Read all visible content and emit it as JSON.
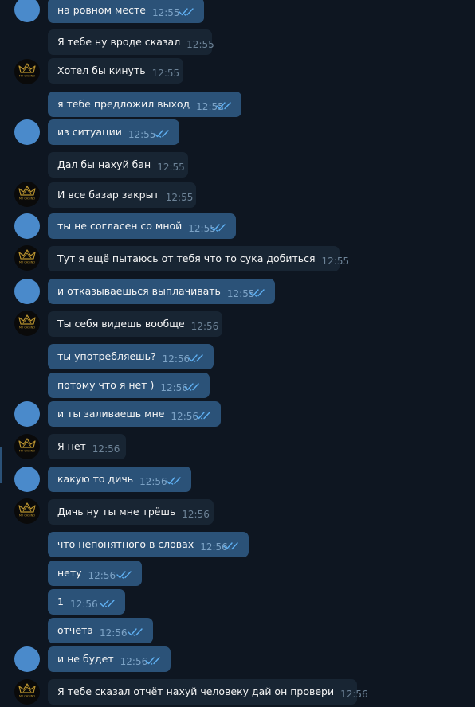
{
  "colors": {
    "background": "#0e1621",
    "outgoing_bubble": "#2b5278",
    "incoming_bubble": "#182533",
    "text": "#f5f5f5",
    "time_incoming": "#6d8397",
    "time_outgoing": "#7da3c6",
    "check_marks": "#5fb0f2",
    "avatar_blue": "#4a8acb",
    "logo_gold": "#b8922f"
  },
  "avatar_logo_text": "MY CASINO",
  "messages": [
    {
      "text": "на ровном месте",
      "time": "12:55",
      "direction": "out",
      "read": true
    },
    {
      "text": "Я тебе ну вроде сказал",
      "time": "12:55",
      "direction": "in",
      "read": false
    },
    {
      "text": "Хотел бы кинуть",
      "time": "12:55",
      "direction": "in",
      "read": false
    },
    {
      "text": "я тебе предложил выход",
      "time": "12:55",
      "direction": "out",
      "read": true
    },
    {
      "text": "из ситуации",
      "time": "12:55",
      "direction": "out",
      "read": true
    },
    {
      "text": "Дал бы нахуй бан",
      "time": "12:55",
      "direction": "in",
      "read": false
    },
    {
      "text": "И все базар закрыт",
      "time": "12:55",
      "direction": "in",
      "read": false
    },
    {
      "text": "ты не согласен со мной",
      "time": "12:55",
      "direction": "out",
      "read": true
    },
    {
      "text": "Тут я ещё пытаюсь от тебя что то сука добиться",
      "time": "12:55",
      "direction": "in",
      "read": false
    },
    {
      "text": "и отказываешься выплачивать",
      "time": "12:55",
      "direction": "out",
      "read": true
    },
    {
      "text": "Ты себя видешь вообще",
      "time": "12:56",
      "direction": "in",
      "read": false
    },
    {
      "text": "ты употребляешь?",
      "time": "12:56",
      "direction": "out",
      "read": true
    },
    {
      "text": "потому что я нет )",
      "time": "12:56",
      "direction": "out",
      "read": true
    },
    {
      "text": "и ты заливаешь мне",
      "time": "12:56",
      "direction": "out",
      "read": true
    },
    {
      "text": "Я нет",
      "time": "12:56",
      "direction": "in",
      "read": false
    },
    {
      "text": "какую то дичь",
      "time": "12:56",
      "direction": "out",
      "read": true
    },
    {
      "text": "Дичь ну ты мне трёшь",
      "time": "12:56",
      "direction": "in",
      "read": false
    },
    {
      "text": "что непонятного в словах",
      "time": "12:56",
      "direction": "out",
      "read": true
    },
    {
      "text": "нету",
      "time": "12:56",
      "direction": "out",
      "read": true
    },
    {
      "text": "1",
      "time": "12:56",
      "direction": "out",
      "read": true
    },
    {
      "text": "отчета",
      "time": "12:56",
      "direction": "out",
      "read": true
    },
    {
      "text": "и не будет",
      "time": "12:56",
      "direction": "out",
      "read": true
    },
    {
      "text": "Я тебе сказал отчёт нахуй человеку дай он провери",
      "time": "12:56",
      "direction": "in",
      "read": false
    }
  ]
}
